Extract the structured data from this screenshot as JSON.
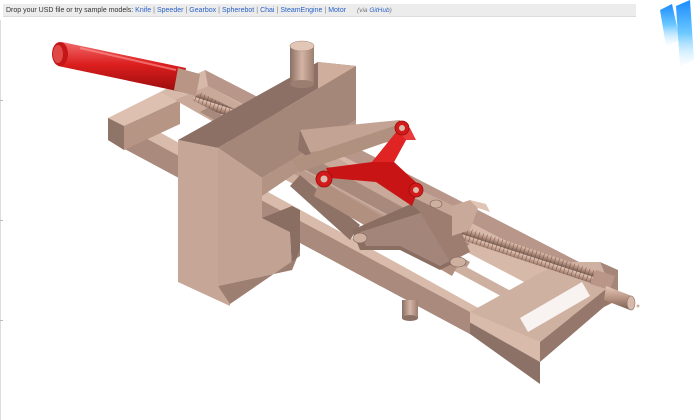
{
  "toolbar": {
    "prompt": "Drop your USD file or try sample models:",
    "samples": [
      "Knife",
      "Speeder",
      "Gearbox",
      "Spherebot",
      "Chai",
      "SteamEngine",
      "Motor"
    ],
    "via_prefix": "(via",
    "via_link": "GitHub",
    "via_suffix": ")"
  },
  "colors": {
    "frame": "#c8a596",
    "handle": "#d21a1a",
    "logo": "#3fa9f5"
  },
  "icons": [
    "cyan-slash-logo-icon",
    "handle-grip-icon"
  ]
}
